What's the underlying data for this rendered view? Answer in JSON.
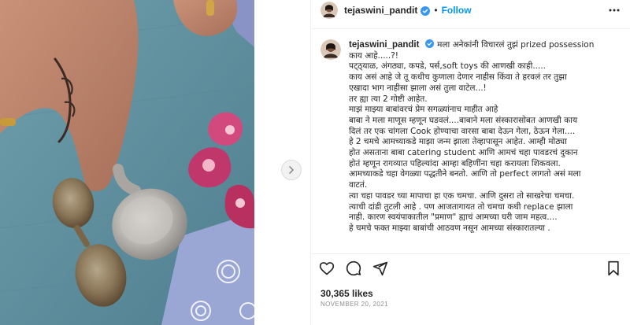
{
  "post": {
    "username": "tejaswini_pandit",
    "separator": "•",
    "follow_label": "Follow"
  },
  "caption": {
    "username": "tejaswini_pandit",
    "lines": [
      "मला अनेकांनी विचारलं तुझं prized possession",
      "काय आहे.....?!",
      "पट्ठ्याळ, अंगठ्या, कपडे, पर्स,soft toys की आणखी काही.....",
      "काय असं आहे जे तू कधीच कुणाला देणार नाहीस किंवा ते हरवलं तर तुझा",
      "एखादा भाग नाहीसा झाला असं तुला वाटेल...!",
      "तर ह्या त्या 2 गोष्टी आहेत.",
      "माझं माझ्या बाबांवरचं प्रेम सगळ्यांनाच माहीत आहे",
      "बाबा ने मला माणूस म्हणून घडवलं....बाबाने मला संस्कारासोबत आणखी काय",
      "दिलं तर एक चांगला Cook होण्याचा वारसा बाबा देऊन गेला, ठेऊन गेला....",
      "हे 2 चमचे आमच्याकडे माझा जन्म झाला तेव्हापासून आहेत. आम्ही मोठ्या",
      "होत असताना बाबा catering student आणि आमचं चहा पावडरचं दुकान",
      "होतं म्हणून रागव्यात पहिल्यांदा आम्हा बहिणींना चहा करायला शिकवला.",
      "आमच्याकडे चहा वेगळ्या पद्धतीने बनतो. आणि तो perfect लागतो असं मला",
      "वाटतं.",
      "त्या चहा पावडर च्या मापाचा हा एक चमचा. आणि दुसरा तो साखरेचा चमचा.",
      "त्याची दांडी तुटली आहे . पण आजतागायत तो चमचा कधी replace झाला",
      "नाही. कारण स्वयंपाकातील \"प्रमाण\" ह्याचं आमच्या घरी जाम महत्व....",
      "हे चमचे फक्त माझ्या बाबांची आठवण नसून आमच्या संस्कारातल्या ."
    ]
  },
  "stats": {
    "likes": "30,365 likes",
    "date": "NOVEMBER 20, 2021"
  },
  "icons": {
    "verified": "verified-badge-icon",
    "more": "more-options-icon",
    "like": "heart-icon",
    "comment": "comment-icon",
    "share": "share-icon",
    "save": "bookmark-icon",
    "next": "chevron-right-icon"
  },
  "colors": {
    "link_blue": "#0095f6",
    "text": "#262626",
    "muted": "#8e8e8e",
    "verified": "#3897f0"
  }
}
